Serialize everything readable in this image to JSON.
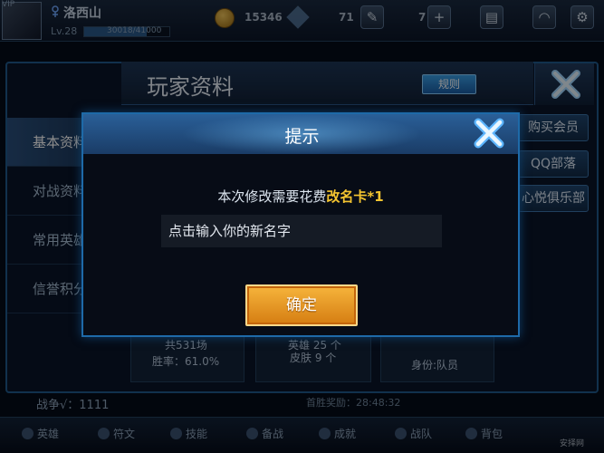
{
  "topbar": {
    "avatar_corner": "VIP",
    "player_name": "洛西山",
    "level": "Lv.28",
    "exp_text": "30018/41000",
    "exp_fraction": 0.73,
    "coin_value": "15346",
    "gem_value": "71",
    "voucher_value": "7",
    "icons": [
      "avatar",
      "gender-icon",
      "coin-icon",
      "diamond-icon",
      "edit-icon",
      "plus-icon",
      "shop-icon",
      "wifi-icon",
      "settings-icon"
    ]
  },
  "panel": {
    "title": "玩家资料",
    "rules_label": "规则",
    "side_tabs": [
      "基本资料",
      "对战资料",
      "常用英雄",
      "信誉积分"
    ],
    "right_buttons": [
      "购买会员",
      "QQ部落",
      "心悦俱乐部"
    ],
    "stats": {
      "card1_line1": "共531场",
      "card1_line2": "胜率：61.0%",
      "card2_line1": "英雄 25 个",
      "card2_line2": "皮肤 9 个",
      "card3_line2": "身份:队员"
    },
    "war_label": "战争√：1111",
    "war_label2": "首胜奖励：28:48:32"
  },
  "bottom_nav": [
    "英雄",
    "符文",
    "技能",
    "备战",
    "成就",
    "战队",
    "背包"
  ],
  "watermark": "安择网",
  "dialog": {
    "title": "提示",
    "message_prefix": "本次修改需要花费",
    "message_item": "改名卡*1",
    "input_placeholder": "点击输入你的新名字",
    "confirm_label": "确定"
  },
  "colors": {
    "accent_blue": "#1e6aa8",
    "highlight_yellow": "#f4c430",
    "confirm_orange": "#e8991f"
  }
}
